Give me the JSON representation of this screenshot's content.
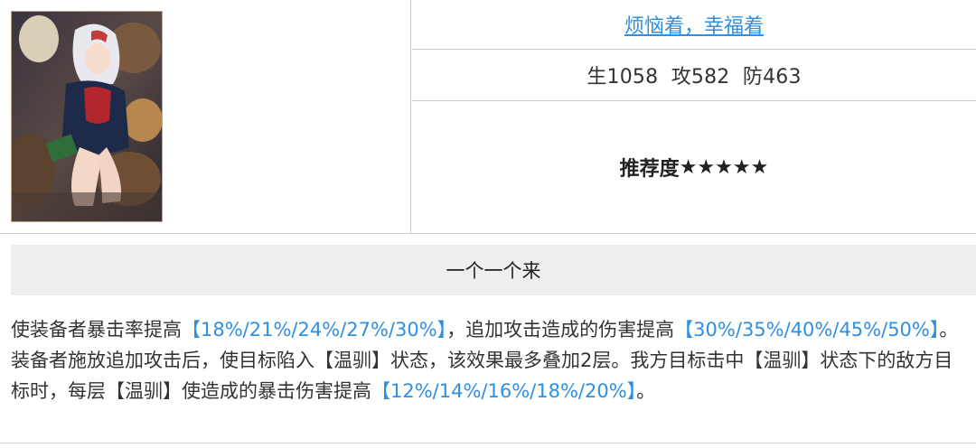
{
  "card": {
    "title": "烦恼着，幸福着",
    "stats": "生1058  攻582  防463",
    "recommend_label": "推荐度",
    "recommend_stars": "★★★★★"
  },
  "skill": {
    "name": "一个一个来",
    "description": [
      {
        "text": "使装备者暴击率提高",
        "highlight": false
      },
      {
        "text": "【18%/21%/24%/27%/30%】",
        "highlight": true
      },
      {
        "text": "，追加攻击造成的伤害提高",
        "highlight": false
      },
      {
        "text": "【30%/35%/40%/45%/50%】",
        "highlight": true
      },
      {
        "text": "。装备者施放追加攻击后，使目标陷入【温驯】状态，该效果最多叠加2层。我方目标击中【温驯】状态下的敌方目标时，每层【温驯】使造成的暴击伤害提高",
        "highlight": false
      },
      {
        "text": "【12%/14%/16%/18%/20%】",
        "highlight": true
      },
      {
        "text": "。",
        "highlight": false
      }
    ]
  },
  "colors": {
    "link": "#2f8fe0",
    "highlight": "#2f8fe0",
    "section_bg": "#eeeeee",
    "border": "#cccccc"
  }
}
